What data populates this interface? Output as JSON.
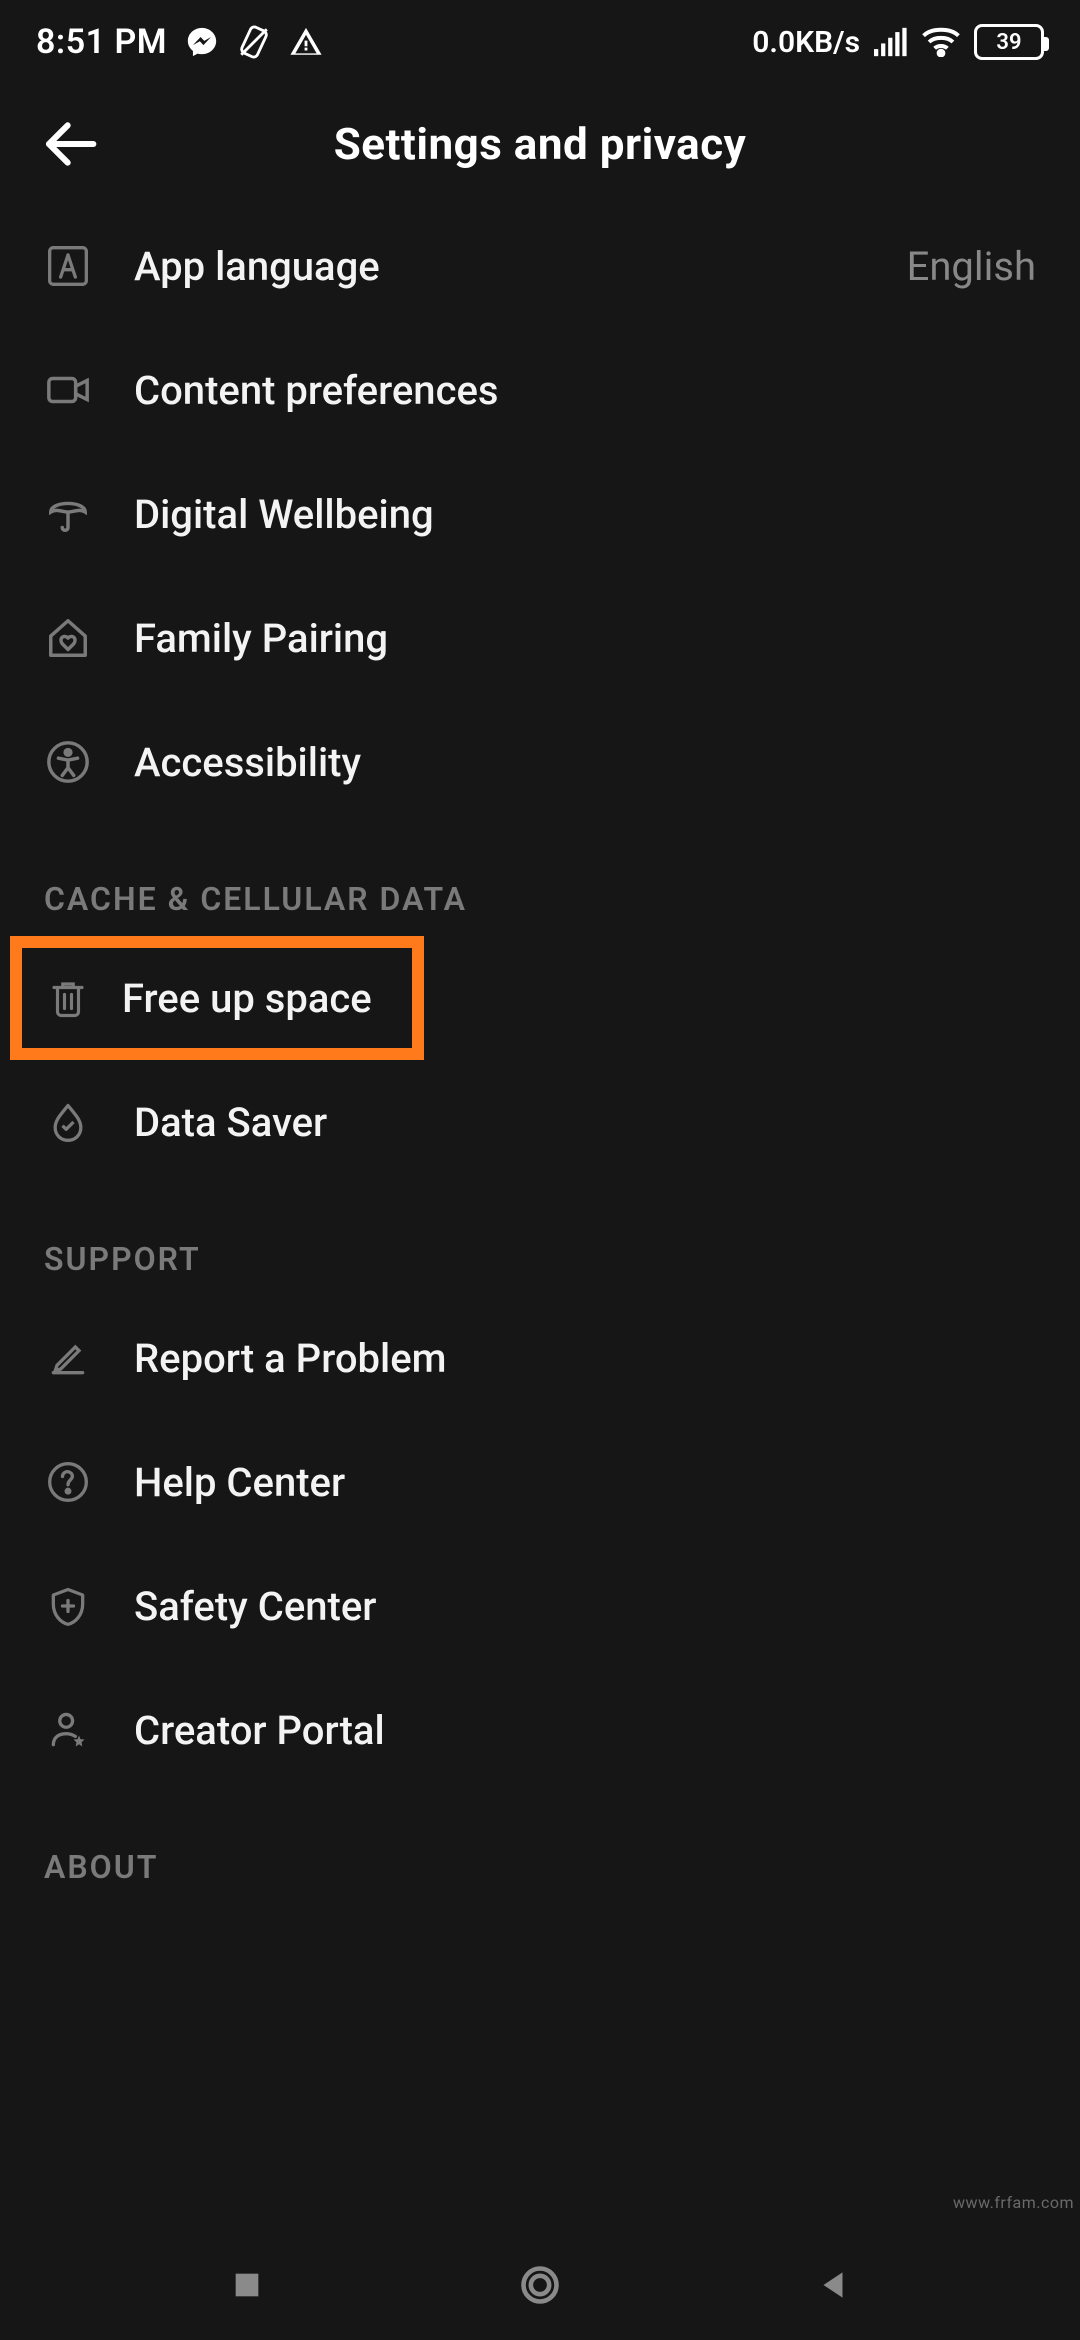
{
  "status": {
    "time": "8:51 PM",
    "data_rate": "0.0KB/s",
    "battery": "39"
  },
  "header": {
    "title": "Settings and privacy"
  },
  "items": {
    "app_language": {
      "label": "App language",
      "value": "English"
    },
    "content_preferences": {
      "label": "Content preferences"
    },
    "digital_wellbeing": {
      "label": "Digital Wellbeing"
    },
    "family_pairing": {
      "label": "Family Pairing"
    },
    "accessibility": {
      "label": "Accessibility"
    },
    "free_up_space": {
      "label": "Free up space"
    },
    "data_saver": {
      "label": "Data Saver"
    },
    "report_problem": {
      "label": "Report a Problem"
    },
    "help_center": {
      "label": "Help Center"
    },
    "safety_center": {
      "label": "Safety Center"
    },
    "creator_portal": {
      "label": "Creator Portal"
    }
  },
  "sections": {
    "cache": "CACHE & CELLULAR DATA",
    "support": "SUPPORT",
    "about": "ABOUT"
  },
  "watermark": "www.frfam.com"
}
